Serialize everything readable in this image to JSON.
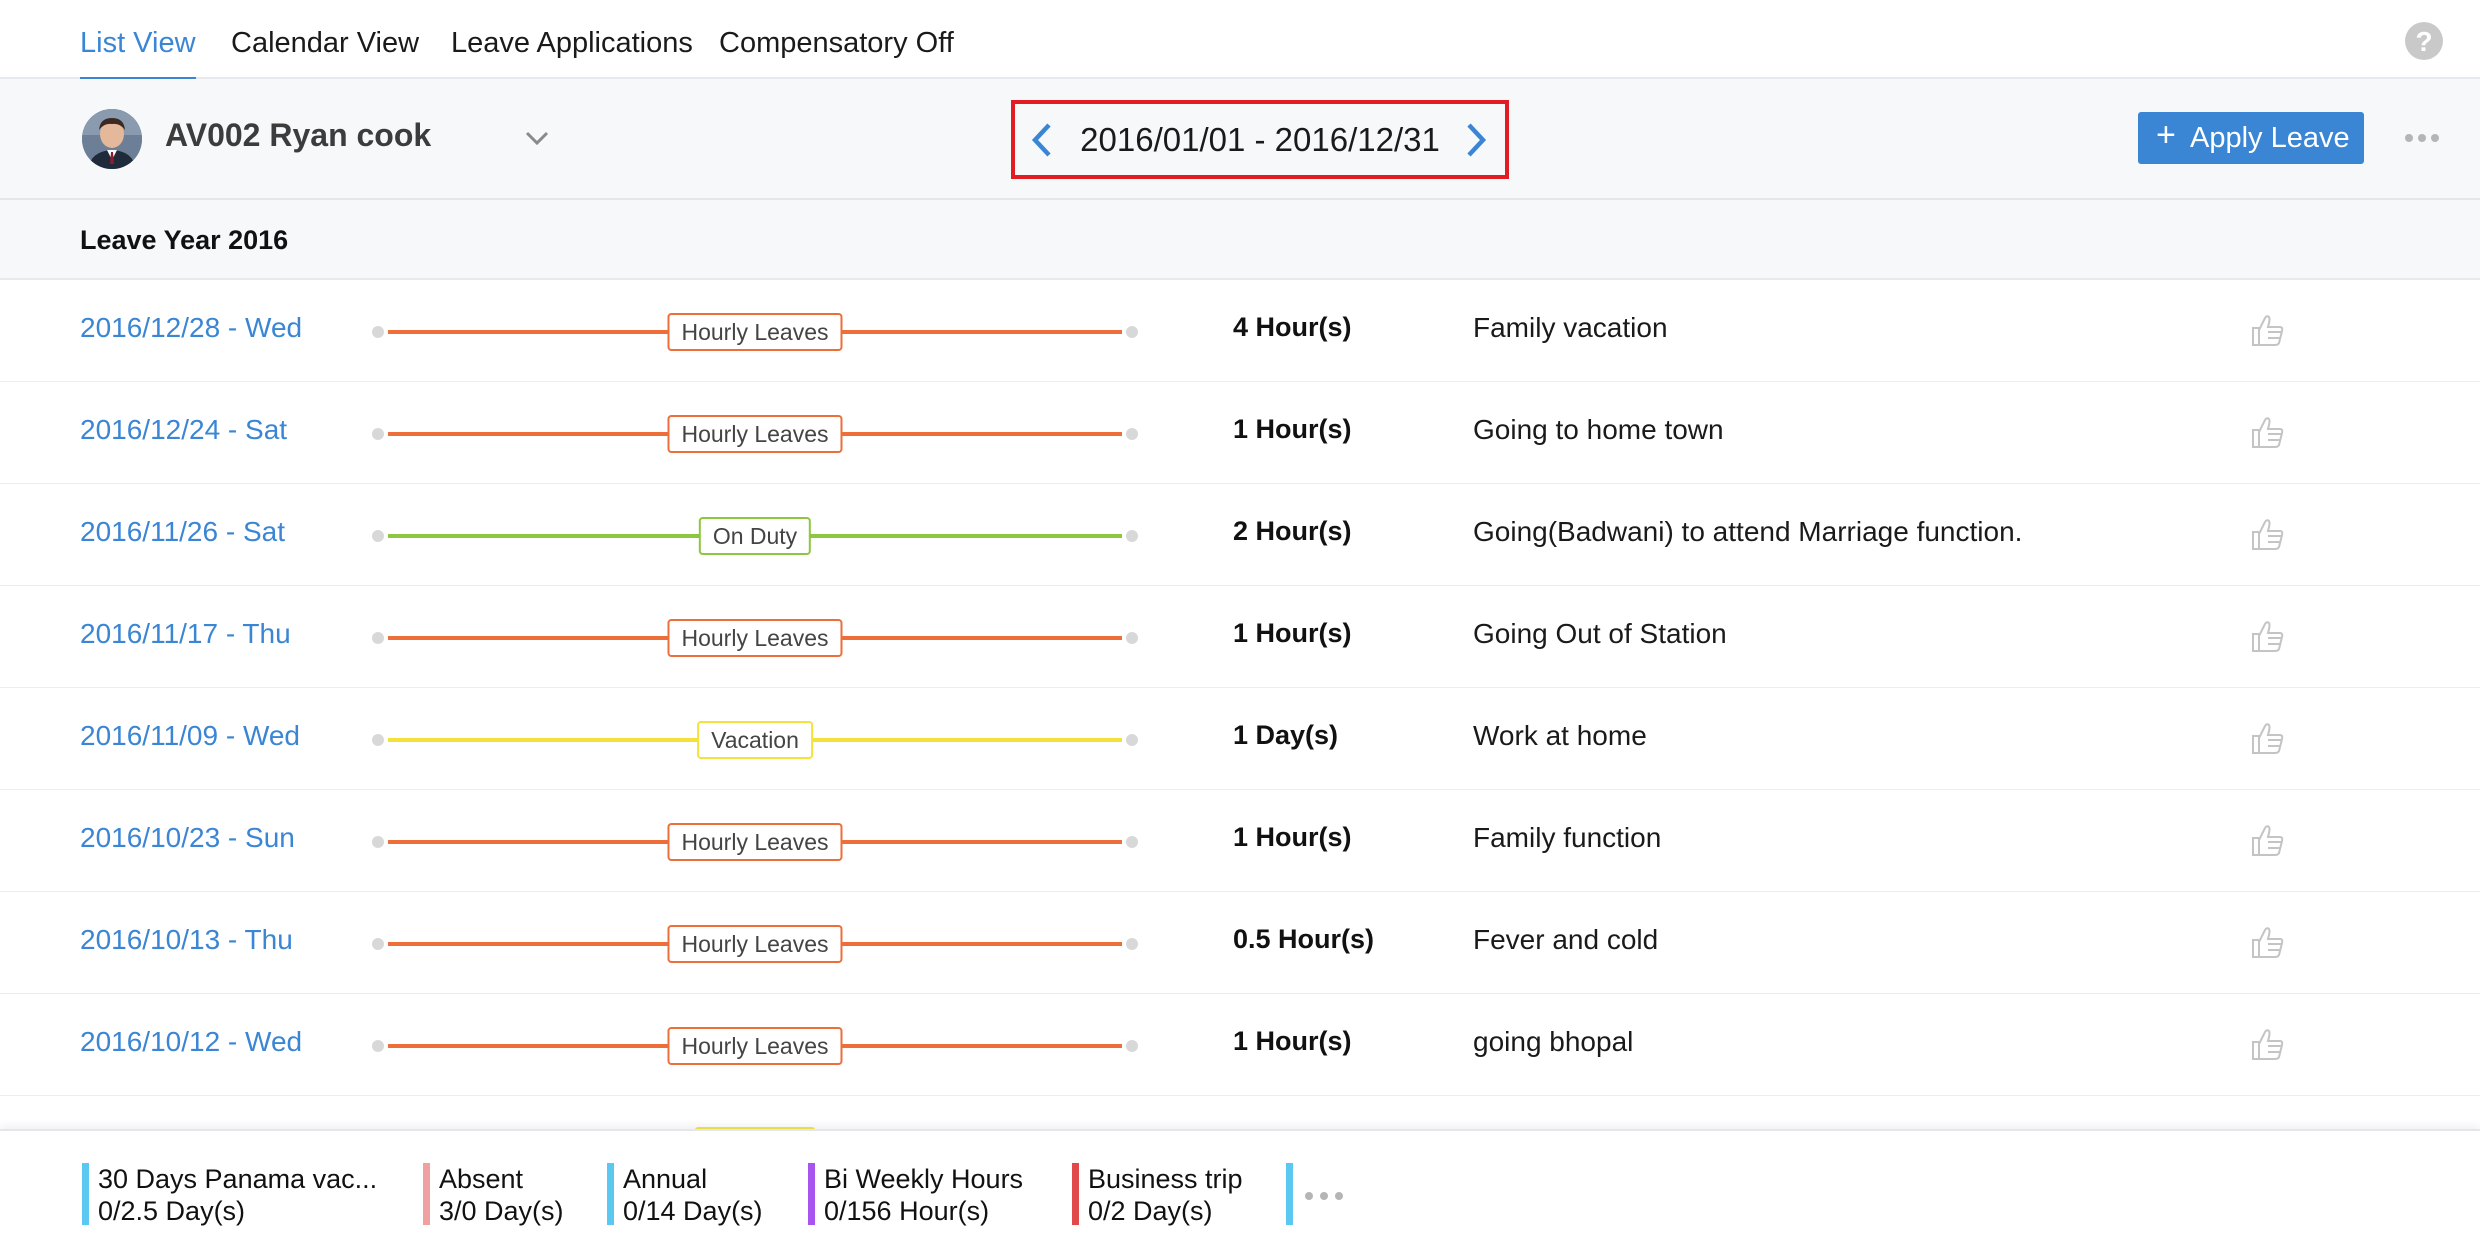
{
  "tabs": [
    {
      "label": "List View",
      "active": true
    },
    {
      "label": "Calendar View",
      "active": false
    },
    {
      "label": "Leave Applications",
      "active": false
    },
    {
      "label": "Compensatory Off",
      "active": false
    }
  ],
  "employee": {
    "name": "AV002 Ryan cook"
  },
  "date_range": {
    "text": "2016/01/01 - 2016/12/31"
  },
  "apply_button": {
    "label": "Apply Leave",
    "color": "#3a86d4"
  },
  "leave_year": {
    "title": "Leave Year 2016"
  },
  "colors": {
    "hourly": "#ee6e3a",
    "on_duty": "#8dc63f",
    "vacation": "#f4e23a",
    "link": "#3a86d4",
    "highlight": "#e31b23"
  },
  "rows": [
    {
      "date": "2016/12/28 - Wed",
      "type": "Hourly Leaves",
      "color": "#ee6e3a",
      "amount": "4 Hour(s)",
      "reason": "Family vacation"
    },
    {
      "date": "2016/12/24 - Sat",
      "type": "Hourly Leaves",
      "color": "#ee6e3a",
      "amount": "1 Hour(s)",
      "reason": "Going to home town"
    },
    {
      "date": "2016/11/26 - Sat",
      "type": "On Duty",
      "color": "#8dc63f",
      "amount": "2 Hour(s)",
      "reason": "Going(Badwani) to attend Marriage function."
    },
    {
      "date": "2016/11/17 - Thu",
      "type": "Hourly Leaves",
      "color": "#ee6e3a",
      "amount": "1 Hour(s)",
      "reason": "Going Out of Station"
    },
    {
      "date": "2016/11/09 - Wed",
      "type": "Vacation",
      "color": "#f4e23a",
      "amount": "1 Day(s)",
      "reason": "Work at home"
    },
    {
      "date": "2016/10/23 - Sun",
      "type": "Hourly Leaves",
      "color": "#ee6e3a",
      "amount": "1 Hour(s)",
      "reason": "Family function"
    },
    {
      "date": "2016/10/13 - Thu",
      "type": "Hourly Leaves",
      "color": "#ee6e3a",
      "amount": "0.5 Hour(s)",
      "reason": "Fever and cold"
    },
    {
      "date": "2016/10/12 - Wed",
      "type": "Hourly Leaves",
      "color": "#ee6e3a",
      "amount": "1 Hour(s)",
      "reason": "going bhopal"
    }
  ],
  "balances": [
    {
      "name": "30 Days Panama vac...",
      "value": "0/2.5 Day(s)",
      "color": "#5ac8f0"
    },
    {
      "name": "Absent",
      "value": "3/0 Day(s)",
      "color": "#f0a0a0"
    },
    {
      "name": "Annual",
      "value": "0/14 Day(s)",
      "color": "#5ac8f0"
    },
    {
      "name": "Bi Weekly Hours",
      "value": "0/156 Hour(s)",
      "color": "#a855f0"
    },
    {
      "name": "Business trip",
      "value": "0/2 Day(s)",
      "color": "#e04a4a"
    }
  ]
}
